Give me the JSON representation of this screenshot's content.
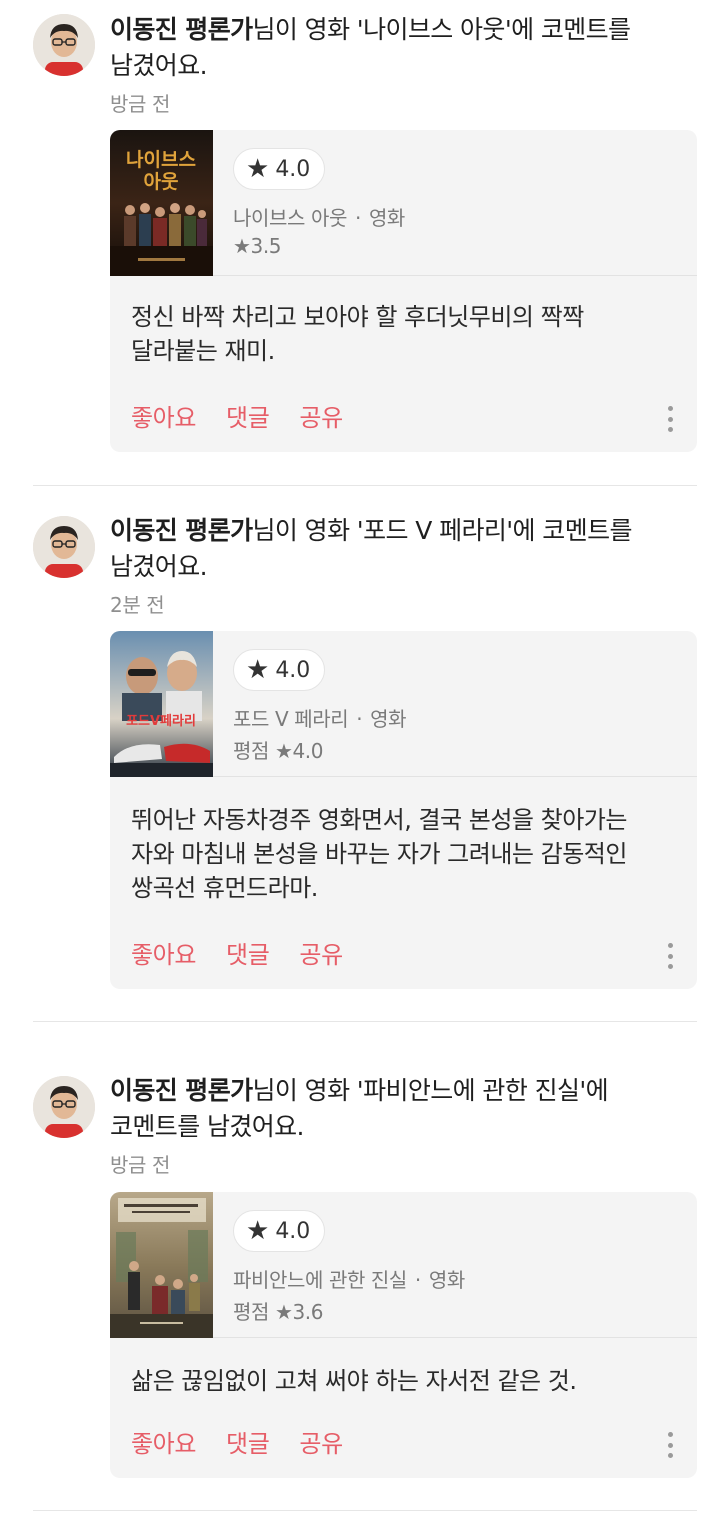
{
  "feed": [
    {
      "user": "이동진 평론가",
      "action_line": "님이 영화 '나이브스 아웃'에 코멘트를",
      "action_line2": "남겼어요.",
      "time": "방금 전",
      "rating_star": "★",
      "rating": "4.0",
      "movie_title": "나이브스 아웃",
      "category": "영화",
      "avg_rating": "★3.5",
      "poster_text": "나이브스 아웃",
      "comment_lines": [
        "정신 바짝 차리고 보아야 할 후더닛무비의 짝짝",
        "달라붙는 재미."
      ],
      "like_label": "좋아요",
      "reply_label": "댓글",
      "share_label": "공유"
    },
    {
      "user": "이동진 평론가",
      "action_line": "님이 영화 '포드 V 페라리'에 코멘트를",
      "action_line2": "남겼어요.",
      "time": "2분 전",
      "rating_star": "★",
      "rating": "4.0",
      "movie_title": "포드 V 페라리",
      "category": "영화",
      "avg_rating": "평점 ★4.0",
      "poster_text": "포드V페라리",
      "comment_lines": [
        "뛰어난 자동차경주 영화면서, 결국 본성을 찾아가는",
        "자와 마침내 본성을 바꾸는 자가 그려내는 감동적인",
        "쌍곡선 휴먼드라마."
      ],
      "like_label": "좋아요",
      "reply_label": "댓글",
      "share_label": "공유"
    },
    {
      "user": "이동진 평론가",
      "action_line": "님이 영화 '파비안느에 관한 진실'에",
      "action_line2": "코멘트를 남겼어요.",
      "time": "방금 전",
      "rating_star": "★",
      "rating": "4.0",
      "movie_title": "파비안느에 관한 진실",
      "category": "영화",
      "avg_rating": "평점 ★3.6",
      "poster_text": "",
      "comment_lines": [
        "삶은 끊임없이 고쳐 써야 하는 자서전 같은 것."
      ],
      "like_label": "좋아요",
      "reply_label": "댓글",
      "share_label": "공유"
    }
  ],
  "colors": {
    "accent": "#e65d67",
    "card_bg": "#f4f4f4",
    "muted_text": "#8f8f8f"
  }
}
